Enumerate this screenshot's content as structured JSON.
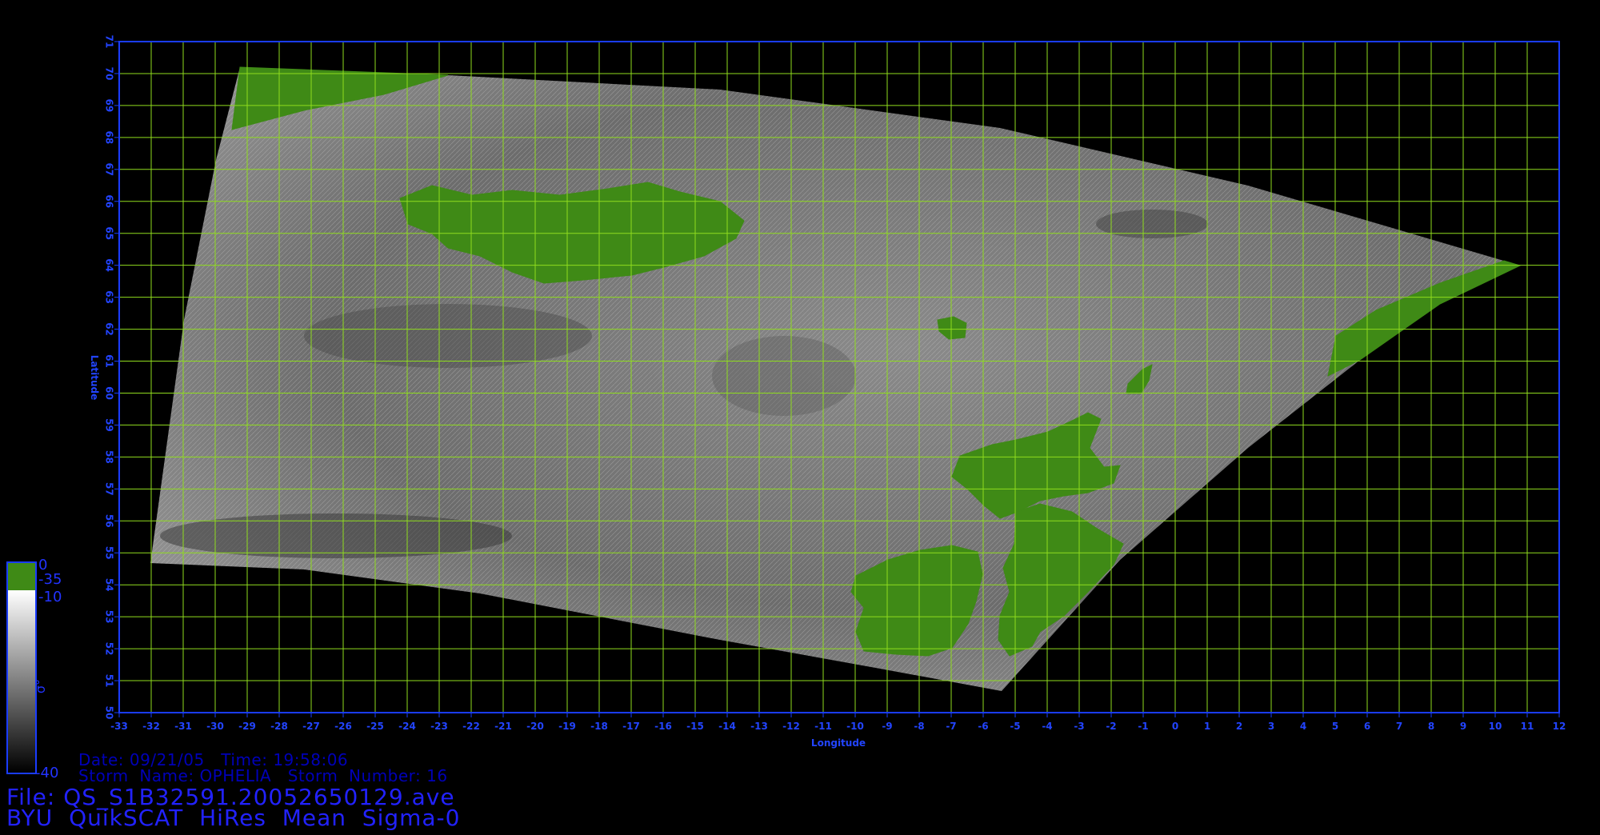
{
  "map": {
    "x_label": "Longitude",
    "y_label": "Latitude",
    "lon_range": [
      -33,
      12
    ],
    "lat_range": [
      50,
      71
    ],
    "lon_ticks": [
      "-33",
      "-32",
      "-31",
      "-30",
      "-29",
      "-28",
      "-27",
      "-26",
      "-25",
      "-24",
      "-23",
      "-22",
      "-21",
      "-20",
      "-19",
      "-18",
      "-17",
      "-16",
      "-15",
      "-14",
      "-13",
      "-12",
      "-11",
      "-10",
      "-9",
      "-8",
      "-7",
      "-6",
      "-5",
      "-4",
      "-3",
      "-2",
      "-1",
      "0",
      "1",
      "2",
      "3",
      "4",
      "5",
      "6",
      "7",
      "8",
      "9",
      "10",
      "11",
      "12"
    ],
    "lat_ticks": [
      "50",
      "51",
      "52",
      "53",
      "54",
      "55",
      "56",
      "57",
      "58",
      "59",
      "60",
      "61",
      "62",
      "63",
      "64",
      "65",
      "66",
      "67",
      "68",
      "69",
      "70",
      "71"
    ],
    "grid_color": "#8fdc1e",
    "frame_color": "#1a3cff",
    "land_color": "#3f8a16"
  },
  "legend": {
    "label_top": "0",
    "label_land": "-35",
    "label_mid": "-10",
    "label_bottom": "-40",
    "symbol": "σ°",
    "land_color": "#3f8a16",
    "gradient_top": "#ffffff",
    "gradient_bottom": "#000000"
  },
  "info": {
    "date_line": "Date: 09/21/05   Time: 19:58:06",
    "storm_line": "Storm  Name: OPHELIA   Storm  Number: 16",
    "file_line": "File: QS_S1B32591.20052650129.ave",
    "product_line": "BYU  QuikSCAT  HiRes  Mean  Sigma-0"
  }
}
